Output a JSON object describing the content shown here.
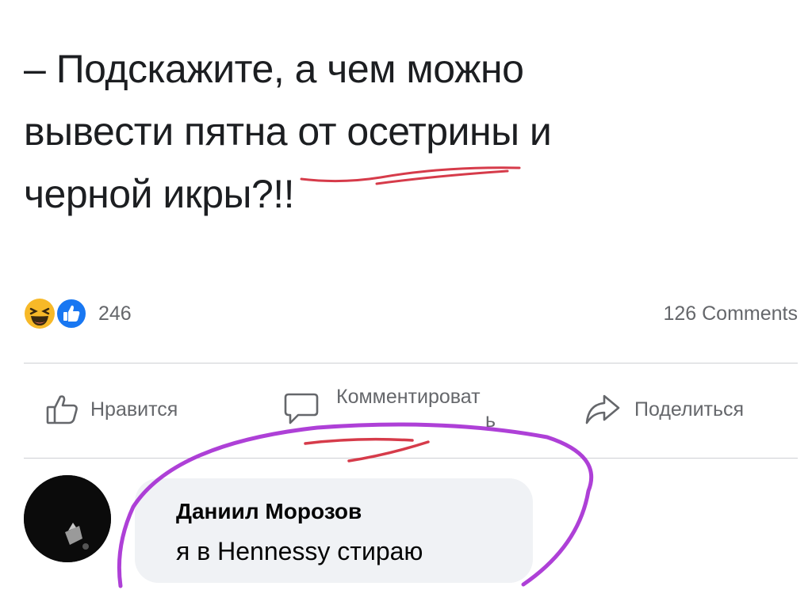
{
  "post": {
    "lines": [
      "– Подскажите, а чем можно",
      "вывести пятна от осетрины и",
      "черной икры?!!"
    ]
  },
  "reactions": {
    "count": "246",
    "icons": [
      "haha-icon",
      "like-icon"
    ]
  },
  "comments_count": "126 Comments",
  "actions": {
    "like": "Нравится",
    "comment_line1": "Комментироват",
    "comment_line2": "ь",
    "share": "Поделиться"
  },
  "comment": {
    "author": "Даниил Морозов",
    "text": "я в Hennessy стираю"
  },
  "colors": {
    "text": "#1c1e21",
    "muted": "#65676b",
    "bubble": "#f0f2f5",
    "like_blue": "#1877f2",
    "haha_yellow": "#f7b928",
    "pen_red": "#d63b4a",
    "pen_purple": "#a01fd0"
  }
}
